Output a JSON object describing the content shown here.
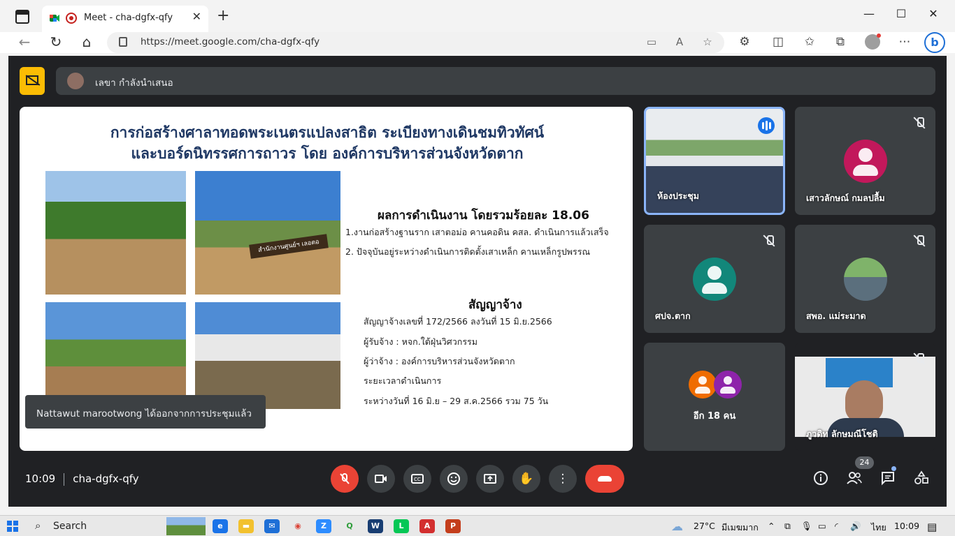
{
  "browser": {
    "tab_title": "Meet - cha-dgfx-qfy",
    "url": "https://meet.google.com/cha-dgfx-qfy"
  },
  "meet": {
    "presenter_label": "เลขา กำลังนำเสนอ",
    "slide": {
      "title_line1": "การก่อสร้างศาลาทอดพระเนตรแปลงสาธิต ระเบียงทางเดินชมทิวทัศน์",
      "title_line2": "และบอร์ดนิทรรศการถาวร โดย องค์การบริหารส่วนจังหวัดตาก",
      "sign_text": "สำนักงานศูนย์ฯ เลอตอ",
      "result_heading": "ผลการดำเนินงาน โดยรวมร้อยละ  18.06",
      "result_items": [
        "1.งานก่อสร้างฐานราก เสาตอม่อ คานคอดิน คสล. ดำเนินการแล้วเสร็จ",
        "2. ปัจจุบันอยู่ระหว่างดำเนินการติดตั้งเสาเหล็ก คานเหล็กรูปพรรณ"
      ],
      "contract_heading": "สัญญาจ้าง",
      "contract_items": [
        "สัญญาจ้างเลขที่  172/2566  ลงวันที่ 15 มิ.ย.2566",
        "ผู้รับจ้าง : หจก.ใต้ฝุ่นวิศวกรรม",
        "ผู้ว่าจ้าง : องค์การบริหารส่วนจังหวัดตาก",
        "ระยะเวลาดำเนินการ",
        "ระหว่างวันที่ 16 มิ.ย – 29 ส.ค.2566 รวม 75 วัน"
      ]
    },
    "toast": "Nattawut marootwong ได้ออกจากการประชุมแล้ว",
    "participants": {
      "room": "ห้องประชุม",
      "p2": "เสาวลักษณ์ กมลปลื้ม",
      "p3": "ศปจ.ตาก",
      "p4": "สพอ. แม่ระมาด",
      "more": "อีก 18 คน",
      "p6": "ภูวดิท ลักษมณีโชติ"
    },
    "time": "10:09",
    "meeting_code": "cha-dgfx-qfy",
    "people_count": "24"
  },
  "taskbar": {
    "search_label": "Search",
    "temperature": "27°C",
    "weather": "มีเมฆมาก",
    "lang": "ไทย",
    "clock": "10:09"
  },
  "colors": {
    "meet_bg": "#202124",
    "tile_bg": "#3c4043",
    "end_call": "#ea4335",
    "presenting_badge": "#fbbc04",
    "slide_title": "#1f3864"
  }
}
